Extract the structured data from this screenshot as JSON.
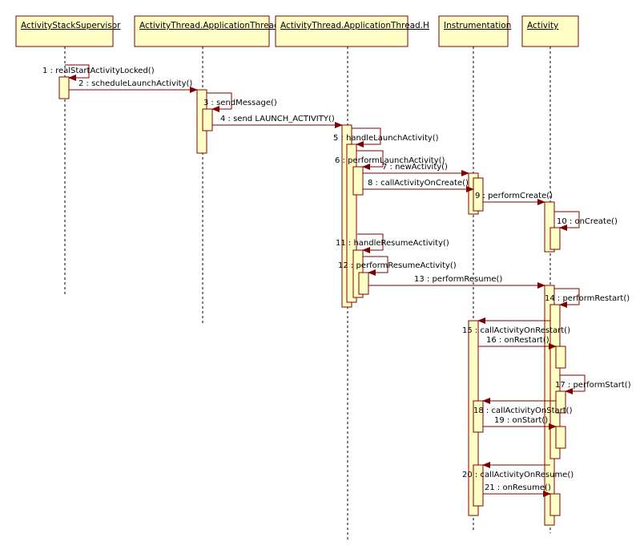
{
  "diagram": {
    "type": "uml-sequence",
    "colors": {
      "box_fill": "#ffffc6",
      "box_stroke": "#800000",
      "arrow": "#800000",
      "lifeline": "#000000"
    },
    "participants": [
      {
        "name": "ActivityStackSupervisor"
      },
      {
        "name": "ActivityThread.ApplicationThread"
      },
      {
        "name": "ActivityThread.ApplicationThread.H"
      },
      {
        "name": "Instrumentation"
      },
      {
        "name": "Activity"
      }
    ],
    "messages": [
      {
        "label": "1 : realStartActivityLocked()",
        "from": "ActivityStackSupervisor",
        "to": "ActivityStackSupervisor"
      },
      {
        "label": "2 : scheduleLaunchActivity()",
        "from": "ActivityStackSupervisor",
        "to": "ActivityThread.ApplicationThread"
      },
      {
        "label": "3 : sendMessage()",
        "from": "ActivityThread.ApplicationThread",
        "to": "ActivityThread.ApplicationThread"
      },
      {
        "label": "4 : send LAUNCH_ACTIVITY()",
        "from": "ActivityThread.ApplicationThread",
        "to": "ActivityThread.ApplicationThread.H"
      },
      {
        "label": "5 : handleLaunchActivity()",
        "from": "ActivityThread.ApplicationThread.H",
        "to": "ActivityThread.ApplicationThread.H"
      },
      {
        "label": "6 : performLaunchActivity()",
        "from": "ActivityThread.ApplicationThread.H",
        "to": "ActivityThread.ApplicationThread.H"
      },
      {
        "label": "7 : newActivity()",
        "from": "ActivityThread.ApplicationThread.H",
        "to": "Instrumentation"
      },
      {
        "label": "8 : callActivityOnCreate()",
        "from": "ActivityThread.ApplicationThread.H",
        "to": "Instrumentation"
      },
      {
        "label": "9 : performCreate()",
        "from": "Instrumentation",
        "to": "Activity"
      },
      {
        "label": "10 : onCreate()",
        "from": "Activity",
        "to": "Activity"
      },
      {
        "label": "11 : handleResumeActivity()",
        "from": "ActivityThread.ApplicationThread.H",
        "to": "ActivityThread.ApplicationThread.H"
      },
      {
        "label": "12 : performResumeActivity()",
        "from": "ActivityThread.ApplicationThread.H",
        "to": "ActivityThread.ApplicationThread.H"
      },
      {
        "label": "13 : performResume()",
        "from": "ActivityThread.ApplicationThread.H",
        "to": "Activity"
      },
      {
        "label": "14 : performRestart()",
        "from": "Activity",
        "to": "Activity"
      },
      {
        "label": "15 : callActivityOnRestart()",
        "from": "Activity",
        "to": "Instrumentation"
      },
      {
        "label": "16 : onRestart()",
        "from": "Instrumentation",
        "to": "Activity"
      },
      {
        "label": "17 : performStart()",
        "from": "Activity",
        "to": "Activity"
      },
      {
        "label": "18 : callActivityOnStart()",
        "from": "Activity",
        "to": "Instrumentation"
      },
      {
        "label": "19 : onStart()",
        "from": "Instrumentation",
        "to": "Activity"
      },
      {
        "label": "20 : callActivityOnResume()",
        "from": "Activity",
        "to": "Instrumentation"
      },
      {
        "label": "21 : onResume()",
        "from": "Instrumentation",
        "to": "Activity"
      }
    ]
  }
}
